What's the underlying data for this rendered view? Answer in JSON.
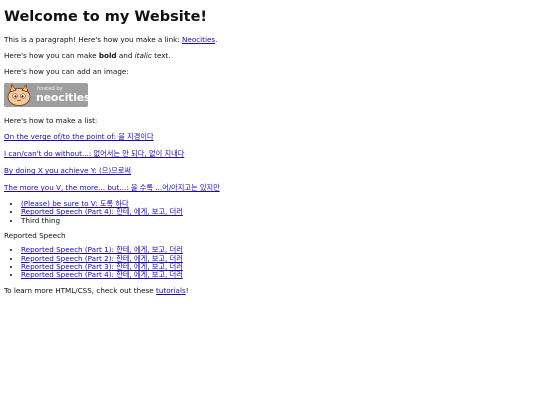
{
  "heading": "Welcome to my Website!",
  "intro": {
    "before_link": "This is a paragraph! Here's how you make a link: ",
    "link_text": "Neocities",
    "after_link": "."
  },
  "format": {
    "before_bold": "Here's how you can make ",
    "bold": "bold",
    "between": " and ",
    "italic": "italic",
    "after": " text."
  },
  "image_text": "Here's how you can add an image:",
  "logo": {
    "hosted_by": "hosted by",
    "brand": "neocities"
  },
  "list_intro": "Here's how to make a list:",
  "list_links": [
    "On the verge of/to the point of: 을 지경이다",
    "I can/can't do without...: 없어서는 안 되다, 없이 지내다",
    "By doing X you achieve Y: (으)므로써",
    "The more you V, the more... but...: 을 수록 ...어/아지고는 있지만"
  ],
  "list1": {
    "items": [
      "(Please) be sure to V: 도록 하다",
      "Reported Speech (Part 4): 한테, 에게, 보고, 더러",
      "Third thing"
    ]
  },
  "reported_speech_label": "Reported Speech",
  "list2": {
    "items": [
      "Reported Speech (Part 1): 한테, 에게, 보고, 더러",
      "Reported Speech (Part 2): 한테, 에게, 보고, 더러",
      "Reported Speech (Part 3): 한테, 에게, 보고, 더러",
      "Reported Speech (Part 4): 한테, 에게, 보고, 더러"
    ]
  },
  "outro": {
    "before_link": "To learn more HTML/CSS, check out these ",
    "link_text": "tutorials",
    "after_link": "!"
  },
  "colors": {
    "link": "#1a0dab",
    "text": "#111111",
    "logo_bg": "#9e9e9e"
  }
}
